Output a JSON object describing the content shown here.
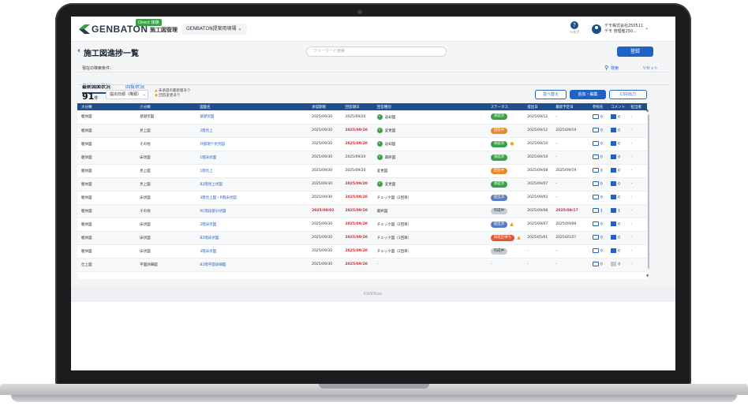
{
  "app": {
    "logo": "GENBATON",
    "trial_badge": "Direct 体験",
    "app_name": "施工図管理",
    "site_selector": "GENBATON提案用現場",
    "help_label": "ヘルプ",
    "user_company": "デモ株式会社250511",
    "user_name": "デモ 管理者250..."
  },
  "page": {
    "title": "施工図進捗一覧",
    "search_placeholder": "フリーワード検索",
    "register_button": "登録",
    "filter_label": "現在の検索条件：",
    "filter_search": "検索",
    "filter_reset": "リセット",
    "tabs": [
      "最新図面状況",
      "回覧状況"
    ],
    "count": "91",
    "count_unit": "件",
    "sort_select": "提出日順（降順）",
    "legend_warning": "未承認の最新版あり",
    "legend_info": "回答変更あり",
    "reorder_button": "並べ替え",
    "bulk_edit_button": "追加・編集",
    "csv_button": "CSV出力"
  },
  "table": {
    "columns": [
      "大分類",
      "小分類",
      "図面名",
      "承認期限",
      "回答期日",
      "回答種別",
      "ステータス",
      "提出日",
      "最新予定日",
      "参照先",
      "コメント",
      "担当者"
    ],
    "rows": [
      {
        "large": "躯体図",
        "small": "基礎伏図",
        "name": "基礎伏図",
        "approve": "2025/09/30",
        "approve_red": false,
        "answer": "2025/09/20",
        "answer_red": false,
        "type": "返却図",
        "type_ok": true,
        "status": "承認済",
        "status_color": "#3aa046",
        "flag": "",
        "submitted": "2025/09/12",
        "latest": "-",
        "latest_red": false,
        "ref": "0",
        "comment": "0",
        "comment_on": true,
        "owner": "-"
      },
      {
        "large": "躯体図",
        "small": "見上図",
        "name": "2階見上",
        "approve": "2025/09/30",
        "approve_red": false,
        "answer": "2025/09/20",
        "answer_red": true,
        "type": "変更図",
        "type_ok": true,
        "status": "回答中",
        "status_color": "#e8892e",
        "flag": "",
        "submitted": "2025/09/12",
        "latest": "2025/09/19",
        "latest_red": false,
        "ref": "0",
        "comment": "0",
        "comment_on": true,
        "owner": "-"
      },
      {
        "large": "躯体図",
        "small": "その他",
        "name": "外部廻り伏見図",
        "approve": "2025/09/30",
        "approve_red": false,
        "answer": "2025/09/20",
        "answer_red": true,
        "type": "返却図",
        "type_ok": true,
        "status": "承認済",
        "status_color": "#3aa046",
        "flag": "info",
        "submitted": "2025/09/10",
        "latest": "-",
        "latest_red": false,
        "ref": "0",
        "comment": "0",
        "comment_on": true,
        "owner": "-"
      },
      {
        "large": "躯体図",
        "small": "床伏図",
        "name": "1階床伏図",
        "approve": "2025/09/30",
        "approve_red": false,
        "answer": "2025/09/20",
        "answer_red": false,
        "type": "最終図",
        "type_ok": true,
        "status": "承認済",
        "status_color": "#3aa046",
        "flag": "",
        "submitted": "2025/09/10",
        "latest": "-",
        "latest_red": false,
        "ref": "0",
        "comment": "0",
        "comment_on": true,
        "owner": "-"
      },
      {
        "large": "躯体図",
        "small": "見上図",
        "name": "1階見上",
        "approve": "2025/09/30",
        "approve_red": false,
        "answer": "2025/09/20",
        "answer_red": false,
        "type": "変更図",
        "type_ok": false,
        "status": "回答中",
        "status_color": "#e8892e",
        "flag": "",
        "submitted": "2025/09/08",
        "latest": "2025/09/19",
        "latest_red": false,
        "ref": "0",
        "comment": "0",
        "comment_on": true,
        "owner": "-"
      },
      {
        "large": "躯体図",
        "small": "見上図",
        "name": "B2階見上伏図",
        "approve": "2025/09/30",
        "approve_red": false,
        "answer": "2025/09/20",
        "answer_red": true,
        "type": "変更図",
        "type_ok": true,
        "status": "承認済",
        "status_color": "#3aa046",
        "flag": "",
        "submitted": "2025/09/07",
        "latest": "-",
        "latest_red": false,
        "ref": "0",
        "comment": "0",
        "comment_on": true,
        "owner": "-"
      },
      {
        "large": "躯体図",
        "small": "床伏図",
        "name": "3階見上図・R階床伏図",
        "approve": "2025/09/30",
        "approve_red": false,
        "answer": "2025/09/20",
        "answer_red": true,
        "type": "チェック図（2回目）",
        "type_ok": false,
        "status": "提出済",
        "status_color": "#5b7bbf",
        "flag": "",
        "submitted": "2025/09/03",
        "latest": "-",
        "latest_red": false,
        "ref": "0",
        "comment": "0",
        "comment_on": true,
        "owner": "-"
      },
      {
        "large": "躯体図",
        "small": "その他",
        "name": "RC階段部分伏図",
        "approve": "2025/09/02",
        "approve_red": true,
        "answer": "2025/09/20",
        "answer_red": true,
        "type": "最終図",
        "type_ok": false,
        "status": "作成中",
        "status_color": "#c6ccd4",
        "flag": "",
        "submitted": "2025/09/08",
        "latest": "2025/09/17",
        "latest_red": true,
        "ref": "1",
        "comment": "1",
        "comment_on": true,
        "owner": "-"
      },
      {
        "large": "躯体図",
        "small": "床伏図",
        "name": "2階床伏図",
        "approve": "2025/09/30",
        "approve_red": false,
        "answer": "2025/09/20",
        "answer_red": true,
        "type": "チェック図（2回目）",
        "type_ok": false,
        "status": "提出済",
        "status_color": "#5b7bbf",
        "flag": "warn",
        "submitted": "2025/09/07",
        "latest": "2025/09/08",
        "latest_red": false,
        "ref": "0",
        "comment": "0",
        "comment_on": true,
        "owner": "-"
      },
      {
        "large": "躯体図",
        "small": "床伏図",
        "name": "B2階床伏図",
        "approve": "2025/09/30",
        "approve_red": false,
        "answer": "2025/09/20",
        "answer_red": true,
        "type": "チェック図（1回目）",
        "type_ok": false,
        "status": "再提出待ち",
        "status_color": "#e2552d",
        "flag": "warn",
        "submitted": "2025/05/01",
        "latest": "2025/05/27",
        "latest_red": false,
        "ref": "0",
        "comment": "0",
        "comment_on": true,
        "owner": "-"
      },
      {
        "large": "躯体図",
        "small": "床伏図",
        "name": "3階床伏図",
        "approve": "2025/09/30",
        "approve_red": false,
        "answer": "2025/09/20",
        "answer_red": true,
        "type": "チェック図（2回目）",
        "type_ok": false,
        "status": "作成中",
        "status_color": "#c6ccd4",
        "flag": "",
        "submitted": "-",
        "latest": "-",
        "latest_red": false,
        "ref": "0",
        "comment": "0",
        "comment_on": true,
        "owner": "-"
      },
      {
        "large": "仕上図",
        "small": "平面詳細図",
        "name": "B2階平面詳細図",
        "approve": "2025/09/30",
        "approve_red": false,
        "answer": "2025/09/20",
        "answer_red": true,
        "type": "-",
        "type_ok": false,
        "status": "-",
        "status_color": "",
        "flag": "",
        "submitted": "-",
        "latest": "-",
        "latest_red": false,
        "ref": "0",
        "comment": "0",
        "comment_on": false,
        "owner": "-"
      }
    ]
  },
  "footer": {
    "copyright": "©SVSTA,Inc."
  },
  "colors": {
    "header_blue": "#1f4e8c",
    "accent": "#1f63c7",
    "brand_green": "#3aa046",
    "deadline_red": "#d8232a"
  }
}
